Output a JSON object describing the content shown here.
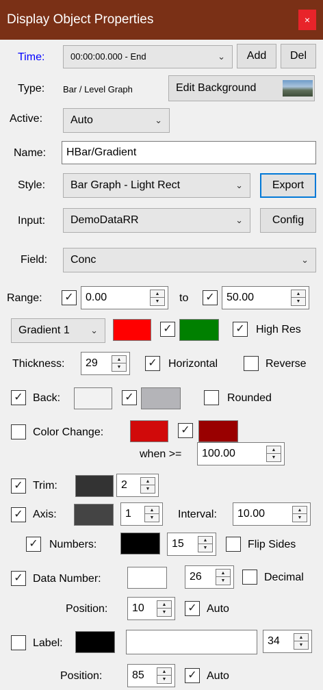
{
  "window": {
    "title": "Display Object Properties",
    "close_glyph": "×"
  },
  "time": {
    "label": "Time:",
    "value": "00:00:00.000 - End",
    "add": "Add",
    "del": "Del",
    "label_color": "#0000ff"
  },
  "type": {
    "label": "Type:",
    "value": "Bar / Level Graph",
    "edit_background": "Edit Background"
  },
  "active": {
    "label": "Active:",
    "value": "Auto"
  },
  "name": {
    "label": "Name:",
    "value": "HBar/Gradient"
  },
  "style": {
    "label": "Style:",
    "value": "Bar Graph - Light Rect",
    "export": "Export"
  },
  "input": {
    "label": "Input:",
    "value": "DemoDataRR",
    "config": "Config"
  },
  "field": {
    "label": "Field:",
    "value": "Conc"
  },
  "range": {
    "label": "Range:",
    "min_checked": true,
    "min": "0.00",
    "to": "to",
    "max_checked": true,
    "max": "50.00"
  },
  "gradient": {
    "value": "Gradient 1",
    "color1": "#ff0000",
    "color2_checked": true,
    "color2": "#008000",
    "high_res_checked": true,
    "high_res": "High Res"
  },
  "thickness": {
    "label": "Thickness:",
    "value": "29",
    "horizontal_checked": true,
    "horizontal": "Horizontal",
    "reverse_checked": false,
    "reverse": "Reverse"
  },
  "back": {
    "checked": true,
    "label": "Back:",
    "color1": "#f2f2f2",
    "color2_checked": true,
    "color2": "#b4b4b8",
    "rounded_checked": false,
    "rounded": "Rounded"
  },
  "color_change": {
    "checked": false,
    "label": "Color Change:",
    "color1": "#d10a0a",
    "color2_checked": true,
    "color2": "#990000",
    "when_label": "when >=",
    "when_value": "100.00"
  },
  "trim": {
    "checked": true,
    "label": "Trim:",
    "color": "#333333",
    "value": "2"
  },
  "axis": {
    "checked": true,
    "label": "Axis:",
    "color": "#444444",
    "value": "1",
    "interval_label": "Interval:",
    "interval": "10.00"
  },
  "numbers": {
    "checked": true,
    "label": "Numbers:",
    "color": "#000000",
    "value": "15",
    "flip_checked": false,
    "flip": "Flip Sides"
  },
  "data_number": {
    "checked": true,
    "label": "Data Number:",
    "color": "#ffffff",
    "value": "26",
    "decimal_checked": false,
    "decimal": "Decimal",
    "position_label": "Position:",
    "position": "10",
    "auto_checked": true,
    "auto": "Auto"
  },
  "label_row": {
    "checked": false,
    "label": "Label:",
    "color": "#000000",
    "text": "",
    "value": "34",
    "position_label": "Position:",
    "position": "85",
    "auto_checked": true,
    "auto": "Auto"
  }
}
